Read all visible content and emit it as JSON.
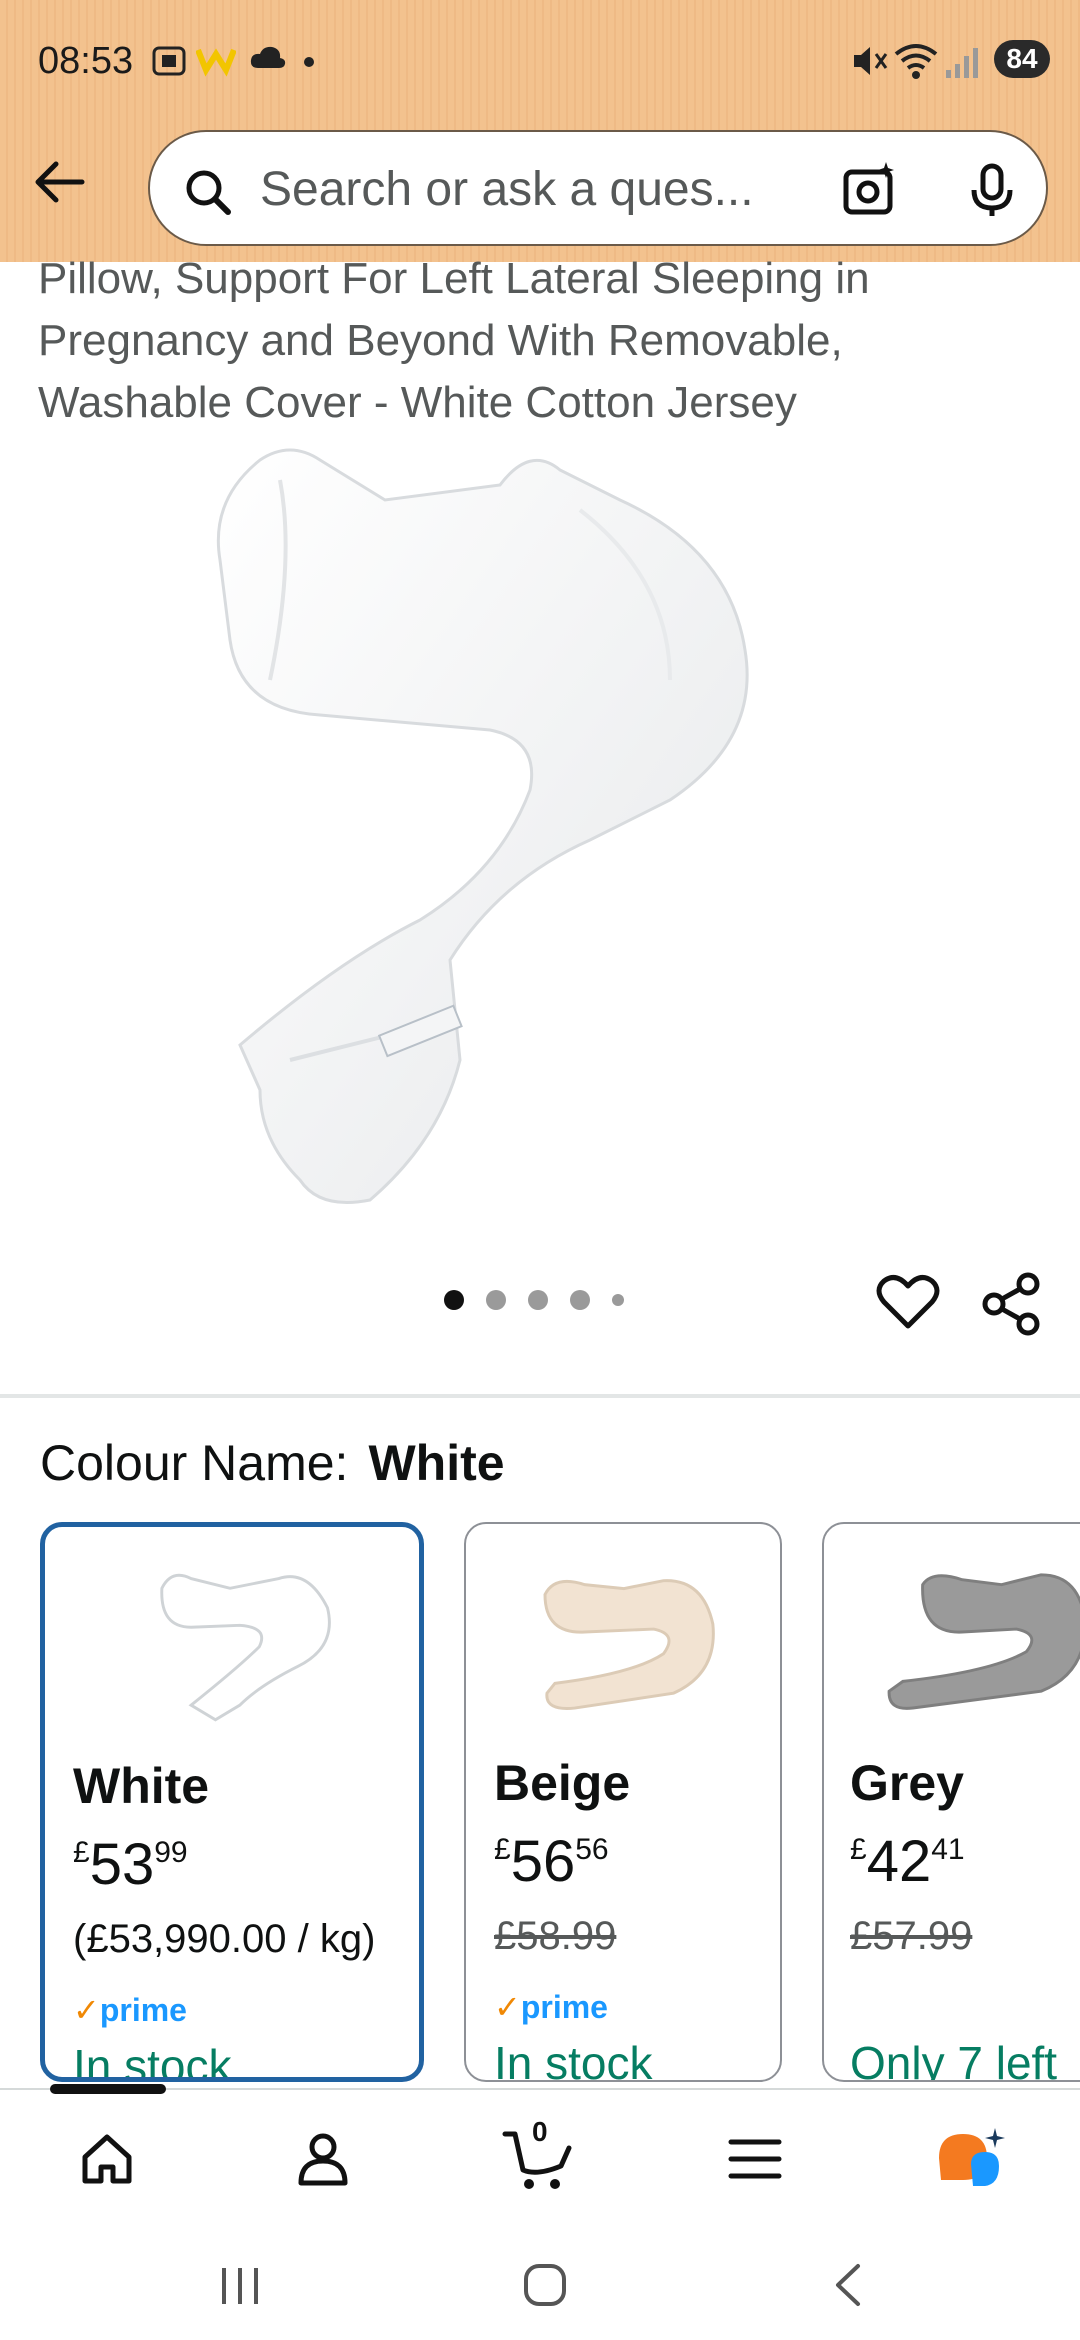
{
  "status_bar": {
    "time": "08:53",
    "battery": "84"
  },
  "search": {
    "placeholder": "Search or ask a ques..."
  },
  "product": {
    "title_lines": [
      "Pillow, Support For Left Lateral Sleeping in",
      "Pregnancy and Beyond With Removable,",
      "Washable Cover - White Cotton Jersey"
    ],
    "image_count": 5,
    "active_image": 1
  },
  "colour": {
    "label": "Colour Name:",
    "selected": "White",
    "options": [
      {
        "name": "White",
        "currency": "£",
        "whole": "53",
        "fraction": "99",
        "sub": "(£53,990.00 / kg)",
        "strike": false,
        "prime": "prime",
        "stock": "In stock",
        "swatch": "#ffffff"
      },
      {
        "name": "Beige",
        "currency": "£",
        "whole": "56",
        "fraction": "56",
        "sub": "£58.99",
        "strike": true,
        "prime": "prime",
        "stock": "In stock",
        "swatch": "#f2e3d2"
      },
      {
        "name": "Grey",
        "currency": "£",
        "whole": "42",
        "fraction": "41",
        "sub": "£57.99",
        "strike": true,
        "prime": "",
        "stock": "Only 7 left",
        "swatch": "#9a9a9a"
      }
    ]
  },
  "bottom_nav": {
    "cart_count": "0"
  },
  "colors": {
    "header": "#f3c28e",
    "link_blue": "#2162a1",
    "stock_green": "#067d62",
    "prime_blue": "#1a98ff"
  }
}
